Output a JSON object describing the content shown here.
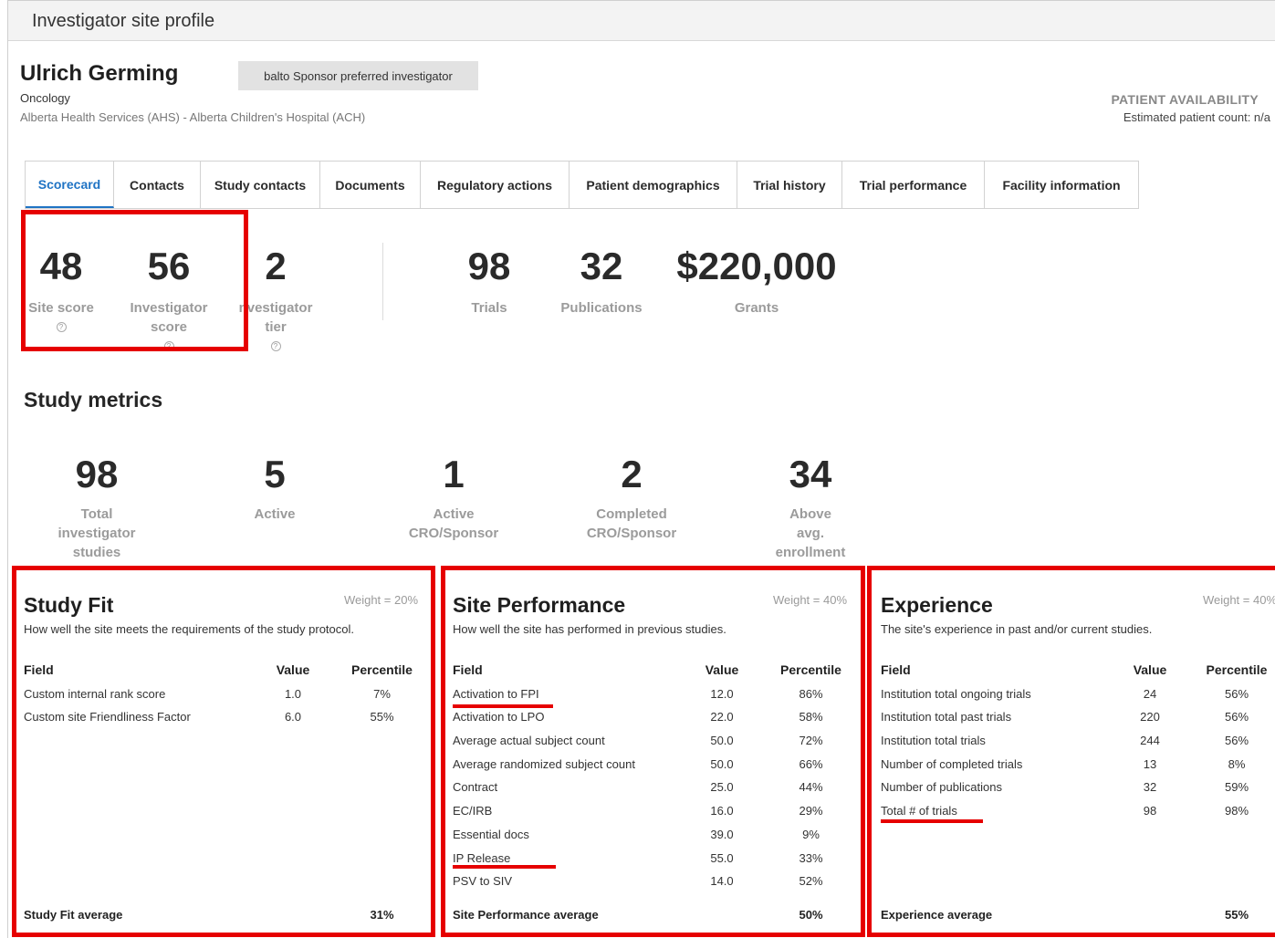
{
  "page": {
    "title": "Investigator site profile"
  },
  "investigator": {
    "name": "Ulrich Germing",
    "badge": "balto Sponsor preferred investigator",
    "specialty": "Oncology",
    "institution": "Alberta Health Services (AHS) - Alberta Children's Hospital (ACH)"
  },
  "patient_availability": {
    "title": "PATIENT AVAILABILITY",
    "count": "Estimated patient count: n/a"
  },
  "tabs": [
    {
      "label": "Scorecard",
      "active": true
    },
    {
      "label": "Contacts"
    },
    {
      "label": "Study contacts"
    },
    {
      "label": "Documents"
    },
    {
      "label": "Regulatory actions"
    },
    {
      "label": "Patient demographics"
    },
    {
      "label": "Trial history"
    },
    {
      "label": "Trial performance"
    },
    {
      "label": "Facility information"
    }
  ],
  "scores": {
    "site_score": {
      "value": "48",
      "label": "Site score"
    },
    "investigator_score": {
      "value": "56",
      "label1": "Investigator",
      "label2": "score"
    },
    "investigator_tier": {
      "value": "2",
      "label1": "nvestigator",
      "label2": "tier"
    },
    "trials": {
      "value": "98",
      "label": "Trials"
    },
    "publications": {
      "value": "32",
      "label": "Publications"
    },
    "grants": {
      "value": "$220,000",
      "label": "Grants"
    }
  },
  "study_metrics": {
    "title": "Study metrics",
    "items": [
      {
        "value": "98",
        "lines": [
          "Total",
          "investigator",
          "studies"
        ]
      },
      {
        "value": "5",
        "lines": [
          "Active"
        ]
      },
      {
        "value": "1",
        "lines": [
          "Active",
          "CRO/Sponsor"
        ]
      },
      {
        "value": "2",
        "lines": [
          "Completed",
          "CRO/Sponsor"
        ]
      },
      {
        "value": "34",
        "lines": [
          "Above",
          "avg.",
          "enrollment"
        ]
      }
    ]
  },
  "panels": {
    "study_fit": {
      "title": "Study Fit",
      "weight": "Weight = 20%",
      "desc": "How well the site meets the requirements of the study protocol.",
      "headers": {
        "field": "Field",
        "value": "Value",
        "percentile": "Percentile"
      },
      "rows": [
        {
          "field": "Custom internal rank score",
          "value": "1.0",
          "pct": "7%"
        },
        {
          "field": "Custom site Friendliness Factor",
          "value": "6.0",
          "pct": "55%"
        }
      ],
      "avg_label": "Study Fit average",
      "avg_value": "31%"
    },
    "site_performance": {
      "title": "Site Performance",
      "weight": "Weight = 40%",
      "desc": "How well the site has performed in previous studies.",
      "headers": {
        "field": "Field",
        "value": "Value",
        "percentile": "Percentile"
      },
      "rows": [
        {
          "field": "Activation to FPI",
          "value": "12.0",
          "pct": "86%"
        },
        {
          "field": "Activation to LPO",
          "value": "22.0",
          "pct": "58%"
        },
        {
          "field": "Average actual subject count",
          "value": "50.0",
          "pct": "72%"
        },
        {
          "field": "Average randomized subject count",
          "value": "50.0",
          "pct": "66%"
        },
        {
          "field": "Contract",
          "value": "25.0",
          "pct": "44%"
        },
        {
          "field": "EC/IRB",
          "value": "16.0",
          "pct": "29%"
        },
        {
          "field": "Essential docs",
          "value": "39.0",
          "pct": "9%"
        },
        {
          "field": "IP Release",
          "value": "55.0",
          "pct": "33%"
        },
        {
          "field": "PSV to SIV",
          "value": "14.0",
          "pct": "52%"
        }
      ],
      "avg_label": "Site Performance average",
      "avg_value": "50%"
    },
    "experience": {
      "title": "Experience",
      "weight": "Weight = 40%",
      "desc": "The site's experience in past and/or current studies.",
      "headers": {
        "field": "Field",
        "value": "Value",
        "percentile": "Percentile"
      },
      "rows": [
        {
          "field": "Institution total ongoing trials",
          "value": "24",
          "pct": "56%"
        },
        {
          "field": "Institution total past trials",
          "value": "220",
          "pct": "56%"
        },
        {
          "field": "Institution total trials",
          "value": "244",
          "pct": "56%"
        },
        {
          "field": "Number of completed trials",
          "value": "13",
          "pct": "8%"
        },
        {
          "field": "Number of publications",
          "value": "32",
          "pct": "59%"
        },
        {
          "field": "Total # of trials",
          "value": "98",
          "pct": "98%"
        }
      ],
      "avg_label": "Experience average",
      "avg_value": "55%"
    }
  },
  "colors": {
    "accent": "#1f73c4",
    "highlight": "#e60000",
    "muted": "#9b9b9b"
  }
}
